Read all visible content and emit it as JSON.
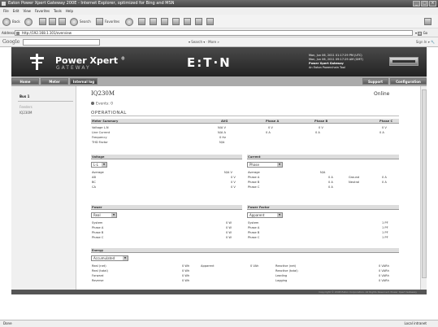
{
  "window": {
    "title": "Eaton Power Xpert Gateway 200E - Internet Explorer, optimized for Bing and MSN"
  },
  "menu": [
    "File",
    "Edit",
    "View",
    "Favorites",
    "Tools",
    "Help"
  ],
  "toolbar": {
    "back": "Back",
    "search": "Search",
    "favorites": "Favorites"
  },
  "address": {
    "label": "Address",
    "url": "http://192.168.1.101/overview",
    "go": "Go"
  },
  "google": {
    "logo": "Google",
    "search_label": "Search",
    "more": "More »",
    "signin": "Sign In"
  },
  "header": {
    "brand": "Power Xpert",
    "reg": "®",
    "sub": "GATEWAY",
    "eaton": "E:T·N",
    "info": [
      "Mon, Jun 06, 2011 01:17:29 PM (UTC)",
      "Mon, Jun 06, 2011 09:17:29 AM (GMT)",
      "Power Xpert Gateway",
      "An Eaton Powerchain Tool"
    ]
  },
  "nav": {
    "home": "Home",
    "meter": "Meter",
    "events": "Internal log",
    "support": "Support",
    "configuration": "Configuration"
  },
  "sidebar": {
    "title": "Bus 1",
    "sub": "Feeders",
    "item": "IQ230M"
  },
  "device": {
    "name": "IQ230M",
    "status": "Online",
    "events": "Events: 0",
    "section": "OPERATIONAL"
  },
  "meter_summary": {
    "headers": [
      "Meter Summary",
      "AVG",
      "Phase A",
      "Phase B",
      "Phase C"
    ],
    "rows": [
      [
        "Voltage L-N",
        "N/A V",
        "0 V",
        "0 V",
        "0 V"
      ],
      [
        "Line Current",
        "N/A A",
        "0 A",
        "0 A",
        "0 A"
      ],
      [
        "Frequency",
        "0 Hz",
        "",
        "",
        ""
      ],
      [
        "THD Factor",
        "N/A",
        "",
        "",
        ""
      ]
    ]
  },
  "voltage": {
    "title": "Voltage",
    "select": "L-L",
    "rows": [
      [
        "Average",
        "N/A V"
      ],
      [
        "AB",
        "0 V"
      ],
      [
        "BC",
        "0 V"
      ],
      [
        "CA",
        "0 V"
      ]
    ]
  },
  "current": {
    "title": "Current",
    "select": "Phase",
    "rows": [
      [
        "Average",
        "N/A",
        ""
      ],
      [
        "Phase A",
        "0 A",
        "Ground"
      ],
      [
        "Phase B",
        "0 A",
        "Neutral"
      ],
      [
        "Phase C",
        "0 A",
        ""
      ]
    ],
    "extra": [
      "0 A",
      "0 A"
    ]
  },
  "power": {
    "title": "Power",
    "select": "Real",
    "rows": [
      [
        "System",
        "0 W"
      ],
      [
        "Phase A",
        "0 W"
      ],
      [
        "Phase B",
        "0 W"
      ],
      [
        "Phase C",
        "0 W"
      ]
    ]
  },
  "power_factor": {
    "title": "Power Factor",
    "select": "Apparent",
    "rows": [
      [
        "System",
        "1 PF"
      ],
      [
        "Phase A",
        "1 PF"
      ],
      [
        "Phase B",
        "1 PF"
      ],
      [
        "Phase C",
        "1 PF"
      ]
    ]
  },
  "energy": {
    "title": "Energy",
    "select": "Accumulated",
    "rows": [
      [
        "Real (net)",
        "0 Wh",
        "Apparent",
        "0 VAh",
        "Reactive (net)",
        "0 VARh"
      ],
      [
        "Real (total)",
        "0 Wh",
        "",
        "",
        "Reactive (total)",
        "0 VARh"
      ],
      [
        "Forward",
        "0 Wh",
        "",
        "",
        "Leading",
        "0 VARh"
      ],
      [
        "Reverse",
        "0 Wh",
        "",
        "",
        "Lagging",
        "0 VARh"
      ]
    ]
  },
  "footer": "Copyright © 2008 Eaton Corporation. All Rights Reserved. Power Xpert Gateway",
  "status": {
    "left": "Done",
    "zone": "Local intranet"
  }
}
